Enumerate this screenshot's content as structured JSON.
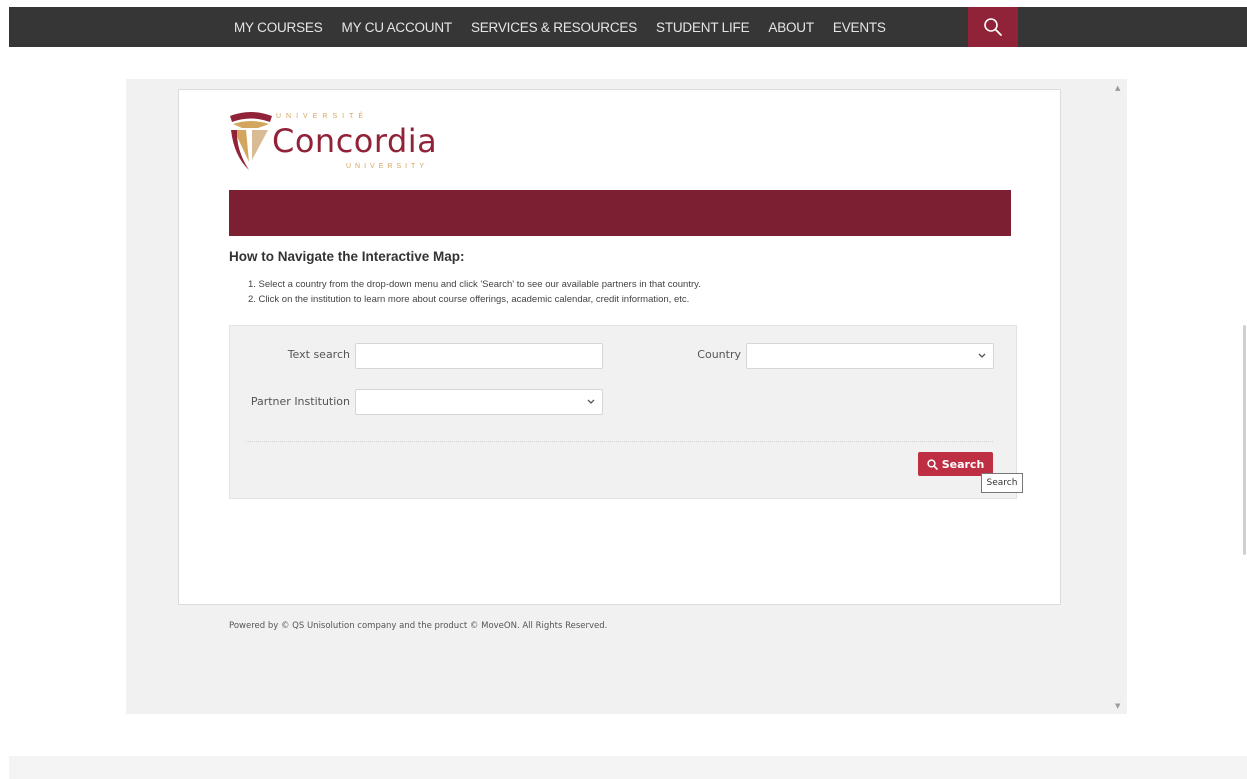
{
  "nav": {
    "items": [
      "MY COURSES",
      "MY CU ACCOUNT",
      "SERVICES & RESOURCES",
      "STUDENT LIFE",
      "ABOUT",
      "EVENTS"
    ],
    "search_icon": "search-icon"
  },
  "logo": {
    "top": "UNIVERSITÉ",
    "word": "Concordia",
    "bottom": "UNIVERSITY"
  },
  "content": {
    "heading": "How to Navigate the Interactive Map:",
    "steps": [
      "1. Select a country from the drop-down menu and click 'Search' to see our available partners in that country.",
      "2. Click on the institution to learn more about course offerings, academic calendar, credit information, etc."
    ]
  },
  "form": {
    "text_search_label": "Text search",
    "text_search_value": "",
    "country_label": "Country",
    "country_value": "",
    "partner_label": "Partner Institution",
    "partner_value": "",
    "search_button": "Search",
    "tooltip": "Search"
  },
  "footer": {
    "text": "Powered by © QS Unisolution company and the product © MoveON. All Rights Reserved."
  },
  "colors": {
    "nav_bg": "#363636",
    "brand_maroon": "#912338",
    "banner": "#7d1f33",
    "button": "#be2f43",
    "gold": "#d4a55c"
  }
}
